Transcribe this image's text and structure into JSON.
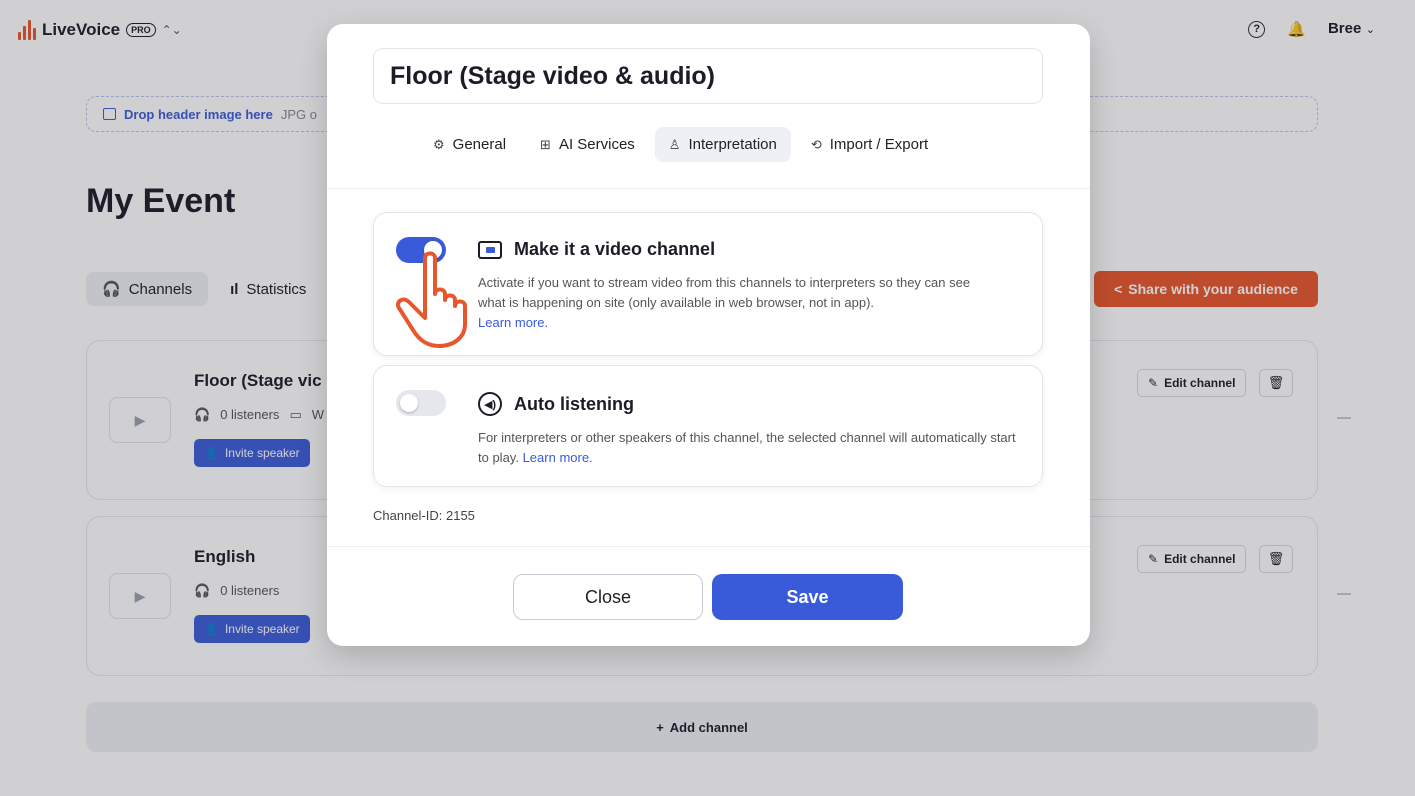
{
  "app": {
    "brand": "LiveVoice",
    "plan_badge": "PRO",
    "help_glyph": "?",
    "user": "Bree",
    "brand_color": "#e8572b",
    "accent_color": "#3a5bd9"
  },
  "header_drop": {
    "label": "Drop header image here",
    "hint": "JPG o"
  },
  "event": {
    "title": "My Event"
  },
  "nav": {
    "tabs": [
      {
        "label": "Channels",
        "icon": "headphones-icon",
        "active": true
      },
      {
        "label": "Statistics",
        "icon": "bar-chart-icon",
        "active": false
      }
    ],
    "share_label": "Share with your audience"
  },
  "channels": [
    {
      "name": "Floor (Stage vic",
      "listeners": "0 listeners",
      "extra": "W",
      "invite_label": "Invite speaker",
      "edit_label": "Edit channel"
    },
    {
      "name": "English",
      "listeners": "0 listeners",
      "extra": "",
      "invite_label": "Invite speaker",
      "edit_label": "Edit channel"
    }
  ],
  "add_channel_label": "Add channel",
  "modal": {
    "title": "Floor (Stage video & audio)",
    "tabs": [
      {
        "label": "General",
        "icon": "gear-icon",
        "active": false
      },
      {
        "label": "AI Services",
        "icon": "chip-icon",
        "active": false
      },
      {
        "label": "Interpretation",
        "icon": "interpreters-icon",
        "active": true
      },
      {
        "label": "Import / Export",
        "icon": "sync-icon",
        "active": false
      }
    ],
    "video_option": {
      "title": "Make it a video channel",
      "description": "Activate if you want to stream video from this channels to interpreters so they can see what is happening on site (only available in web browser, not in app).",
      "link": "Learn more.",
      "enabled": true
    },
    "auto_option": {
      "title": "Auto listening",
      "description": "For interpreters or other speakers of this channel, the selected channel will automatically start to play.",
      "link": "Learn more.",
      "enabled": false
    },
    "channel_id": "Channel-ID: 2155",
    "close_label": "Close",
    "save_label": "Save"
  }
}
